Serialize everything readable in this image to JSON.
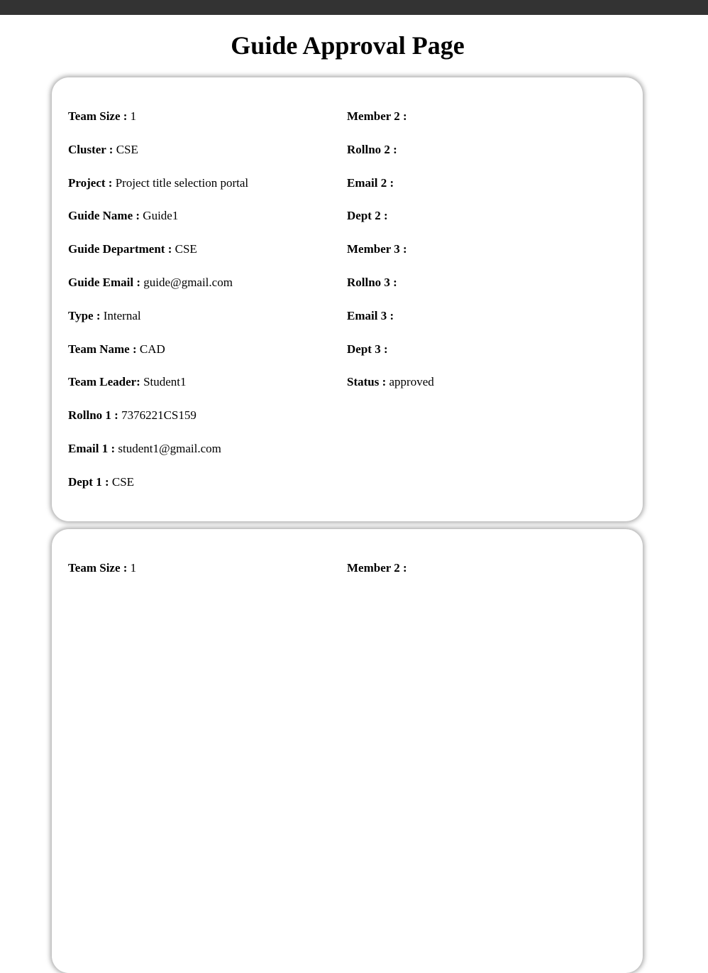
{
  "page": {
    "title": "Guide Approval Page"
  },
  "cards": [
    {
      "left": [
        {
          "label": "Team Size :",
          "value": "1"
        },
        {
          "label": "Cluster :",
          "value": "CSE"
        },
        {
          "label": "Project :",
          "value": "Project title selection portal"
        },
        {
          "label": "Guide Name :",
          "value": "Guide1"
        },
        {
          "label": "Guide Department :",
          "value": "CSE"
        },
        {
          "label": "Guide Email :",
          "value": "guide@gmail.com"
        },
        {
          "label": "Type :",
          "value": "Internal"
        },
        {
          "label": "Team Name :",
          "value": "CAD"
        },
        {
          "label": "Team Leader:",
          "value": "Student1"
        },
        {
          "label": "Rollno 1 :",
          "value": "7376221CS159"
        },
        {
          "label": "Email 1 :",
          "value": "student1@gmail.com"
        },
        {
          "label": "Dept 1 :",
          "value": "CSE"
        }
      ],
      "right": [
        {
          "label": "Member 2 :",
          "value": ""
        },
        {
          "label": "Rollno 2 :",
          "value": ""
        },
        {
          "label": "Email 2 :",
          "value": ""
        },
        {
          "label": "Dept 2 :",
          "value": ""
        },
        {
          "label": "Member 3 :",
          "value": ""
        },
        {
          "label": "Rollno 3 :",
          "value": ""
        },
        {
          "label": "Email 3 :",
          "value": ""
        },
        {
          "label": "Dept 3 :",
          "value": ""
        },
        {
          "label": "Status :",
          "value": "approved"
        }
      ]
    },
    {
      "left": [
        {
          "label": "Team Size :",
          "value": "1"
        }
      ],
      "right": [
        {
          "label": "Member 2 :",
          "value": ""
        }
      ]
    }
  ]
}
